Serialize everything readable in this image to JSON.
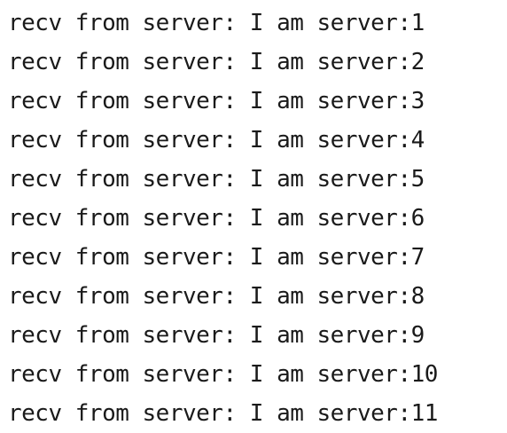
{
  "terminal": {
    "lines": [
      "recv from server: I am server:1",
      "recv from server: I am server:2",
      "recv from server: I am server:3",
      "recv from server: I am server:4",
      "recv from server: I am server:5",
      "recv from server: I am server:6",
      "recv from server: I am server:7",
      "recv from server: I am server:8",
      "recv from server: I am server:9",
      "recv from server: I am server:10",
      "recv from server: I am server:11"
    ]
  },
  "colors": {
    "background": "#ffffff",
    "text": "#1a1a1a"
  }
}
